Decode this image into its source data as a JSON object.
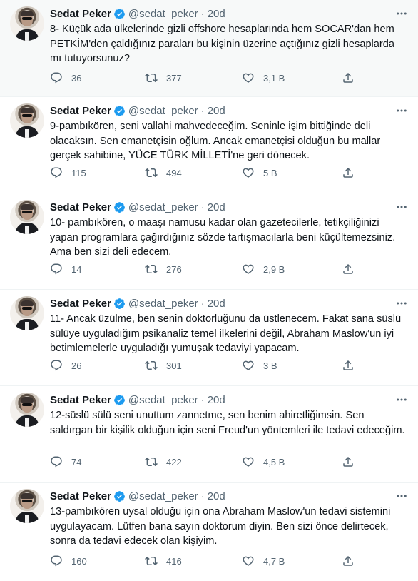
{
  "colors": {
    "text": "#0f1419",
    "muted": "#536471",
    "verified": "#1d9bf0",
    "divider": "#eff3f4"
  },
  "icons": {
    "verified": "verified-badge-icon",
    "more": "more-horizontal-icon",
    "reply": "reply-icon",
    "retweet": "retweet-icon",
    "like": "heart-icon",
    "share": "share-icon"
  },
  "tweets": [
    {
      "name": "Sedat Peker",
      "handle": "@sedat_peker",
      "dot": "·",
      "time": "20d",
      "text": "8- Küçük ada ülkelerinde gizli offshore hesaplarında hem SOCAR'dan hem PETKİM'den çaldığınız paraları bu kişinin üzerine açtığınız gizli hesaplarda mı tutuyorsunuz?",
      "replies": "36",
      "retweets": "377",
      "likes": "3,1 B"
    },
    {
      "name": "Sedat Peker",
      "handle": "@sedat_peker",
      "dot": "·",
      "time": "20d",
      "text": "9-pambıkören, seni vallahi mahvedeceğim. Seninle işim bittiğinde deli olacaksın. Sen emanetçisin oğlum. Ancak emanetçisi olduğun bu mallar gerçek sahibine, YÜCE TÜRK MİLLETİ'ne geri dönecek.",
      "replies": "115",
      "retweets": "494",
      "likes": "5 B"
    },
    {
      "name": "Sedat Peker",
      "handle": "@sedat_peker",
      "dot": "·",
      "time": "20d",
      "text": "10- pambıkören, o maaşı namusu kadar olan gazetecilerle, tetikçiliğinizi yapan programlara çağırdığınız sözde tartışmacılarla beni küçültemezsiniz. Ama ben sizi deli edecem.",
      "replies": "14",
      "retweets": "276",
      "likes": "2,9 B"
    },
    {
      "name": "Sedat Peker",
      "handle": "@sedat_peker",
      "dot": "·",
      "time": "20d",
      "text": "11- Ancak üzülme, ben senin doktorluğunu da üstlenecem. Fakat sana süslü sülüye uyguladığım psikanaliz temel ilkelerini değil, Abraham Maslow'un iyi betimlemelerle uyguladığı yumuşak tedaviyi yapacam.",
      "replies": "26",
      "retweets": "301",
      "likes": "3 B"
    },
    {
      "name": "Sedat Peker",
      "handle": "@sedat_peker",
      "dot": "·",
      "time": "20d",
      "text": "12-süslü sülü seni unuttum zannetme, sen benim ahiretliğimsin. Sen saldırgan bir kişilik olduğun için seni Freud'un yöntemleri ile tedavi edeceğim.",
      "replies": "74",
      "retweets": "422",
      "likes": "4,5 B"
    },
    {
      "name": "Sedat Peker",
      "handle": "@sedat_peker",
      "dot": "·",
      "time": "20d",
      "text": "13-pambıkören uysal olduğu için ona Abraham Maslow'un tedavi sistemini uygulayacam. Lütfen bana sayın doktorum diyin. Ben sizi önce delirtecek, sonra da tedavi edecek olan kişiyim.",
      "replies": "160",
      "retweets": "416",
      "likes": "4,7 B"
    }
  ]
}
